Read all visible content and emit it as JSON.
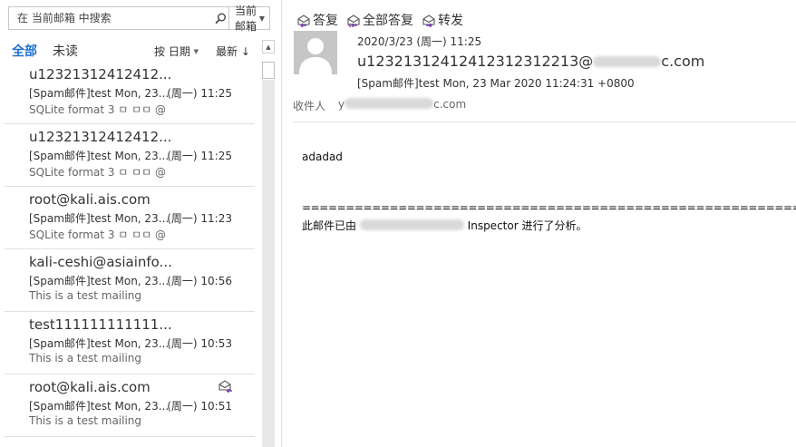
{
  "search": {
    "placeholder": "在 当前邮箱 中搜索",
    "scope": "当前邮箱"
  },
  "filters": {
    "all": "全部",
    "unread": "未读",
    "sort_by": "按 日期",
    "sort_order": "最新"
  },
  "messages": [
    {
      "sender": "u12321312412412...",
      "subject": "[Spam邮件]test Mon, 23...",
      "time": "(周一) 11:25",
      "preview": "SQLite format 3 ㅁ ㅁㅁ @"
    },
    {
      "sender": "u12321312412412...",
      "subject": "[Spam邮件]test Mon, 23...",
      "time": "(周一) 11:25",
      "preview": "SQLite format 3 ㅁ ㅁㅁ @"
    },
    {
      "sender": "root@kali.ais.com",
      "subject": "[Spam邮件]test Mon, 23...",
      "time": "(周一) 11:23",
      "preview": "SQLite format 3 ㅁ ㅁㅁ @"
    },
    {
      "sender": "kali-ceshi@asiainfo...",
      "subject": "[Spam邮件]test Mon, 23...",
      "time": "(周一) 10:56",
      "preview": "This is a test mailing"
    },
    {
      "sender": "test111111111111...",
      "subject": "[Spam邮件]test Mon, 23...",
      "time": "(周一) 10:53",
      "preview": "This is a test mailing"
    },
    {
      "sender": "root@kali.ais.com",
      "subject": "[Spam邮件]test Mon, 23...",
      "time": "(周一) 10:51",
      "preview": "This is a test mailing",
      "icon": "envelope-arrow-icon"
    }
  ],
  "toolbar": {
    "reply": "答复",
    "reply_all": "全部答复",
    "forward": "转发"
  },
  "header": {
    "date": "2020/3/23 (周一) 11:25",
    "from_prefix": "u12321312412412312312213@",
    "from_suffix": "c.com",
    "subject": "[Spam邮件]test Mon, 23 Mar 2020 11:24:31 +0800",
    "to_label": "收件人",
    "to_prefix": "y",
    "to_suffix": "c.com"
  },
  "body": {
    "text": "adadad",
    "separator": "=========================================================",
    "note_prefix": "此邮件已由",
    "note_middle": "Inspector",
    "note_suffix": "进行了分析。"
  },
  "colors": {
    "accent": "#1e6fd0",
    "reply_icon": "#7a3fb0"
  }
}
